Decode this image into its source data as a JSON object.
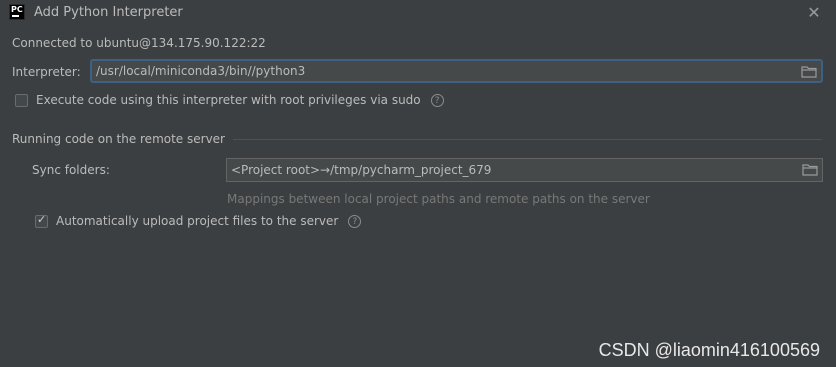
{
  "window": {
    "title": "Add Python Interpreter",
    "app_icon_text": "PC"
  },
  "connection": {
    "text": "Connected to ubuntu@134.175.90.122:22"
  },
  "interpreter": {
    "label": "Interpreter:",
    "value": "/usr/local/miniconda3/bin//python3"
  },
  "sudo_option": {
    "label": "Execute code using this interpreter with root privileges via sudo",
    "checked": false
  },
  "remote_section": {
    "title": "Running code on the remote server",
    "sync_label": "Sync folders:",
    "sync_value": "<Project root>→/tmp/pycharm_project_679",
    "hint": "Mappings between local project paths and remote paths on the server",
    "auto_upload_label": "Automatically upload project files to the server",
    "auto_upload_checked": true
  },
  "watermark": "CSDN @liaomin416100569",
  "icons": {
    "app": "pycharm-icon",
    "close": "close-icon",
    "folder": "folder-icon",
    "help": "help-icon"
  }
}
